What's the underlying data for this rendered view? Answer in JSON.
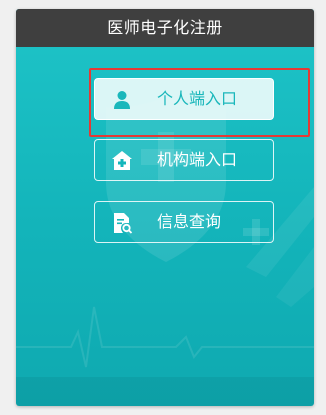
{
  "header": {
    "title": "医师电子化注册"
  },
  "entries": [
    {
      "label": "个人端入口",
      "icon": "person-icon",
      "active": true
    },
    {
      "label": "机构端入口",
      "icon": "hospital-icon",
      "active": false
    },
    {
      "label": "信息查询",
      "icon": "document-search-icon",
      "active": false
    }
  ],
  "colors": {
    "header_bg": "#3f3f3f",
    "panel_teal": "#1ec4c8",
    "panel_teal_dark": "#0fa9b0",
    "highlight_border": "#e53935",
    "active_button_bg": "#ebfafa",
    "active_text": "#1ab7bb"
  }
}
